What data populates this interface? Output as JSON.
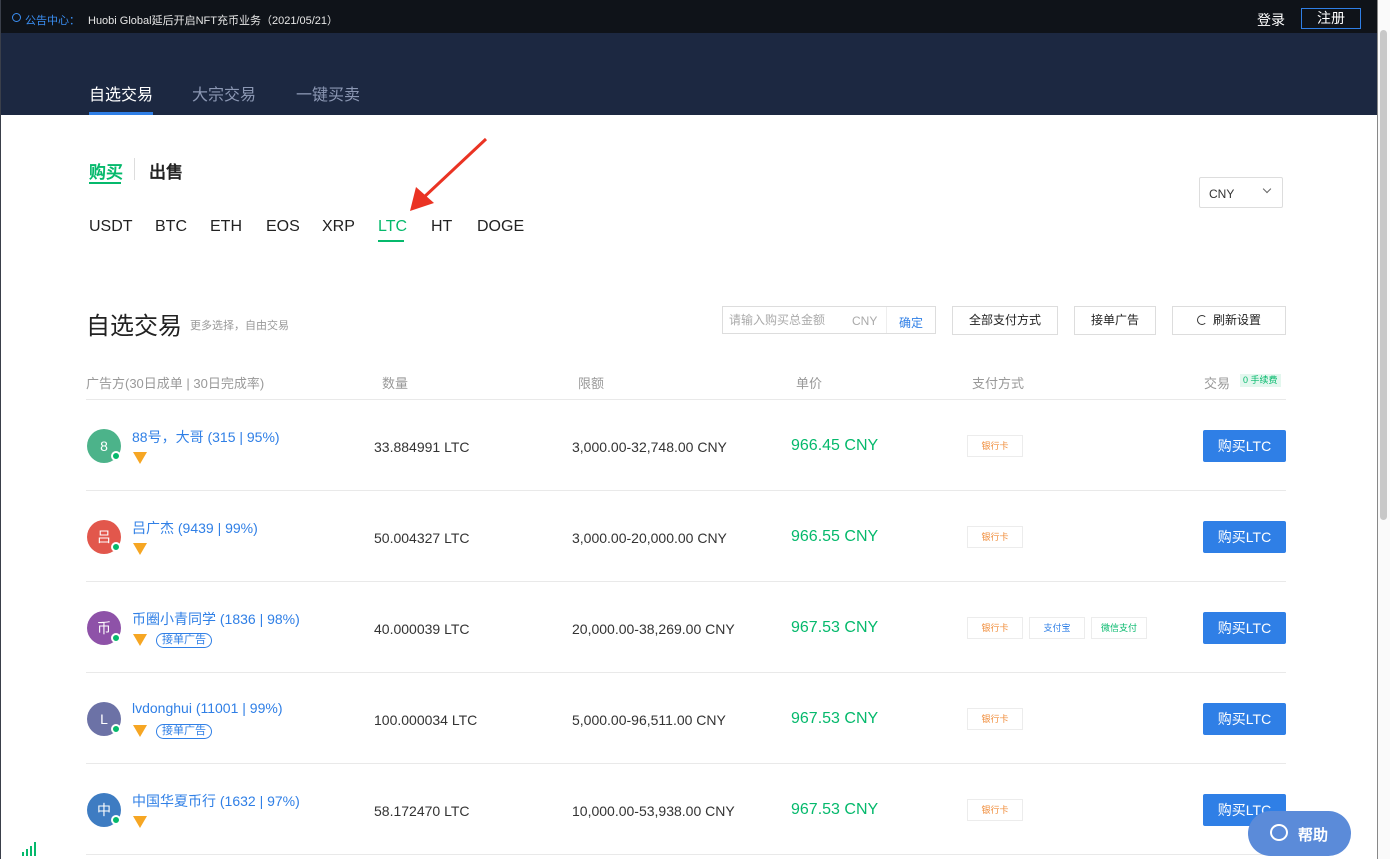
{
  "notice": {
    "label": "公告中心：",
    "text": "Huobi Global延后开启NFT充币业务（2021/05/21）",
    "login": "登录",
    "register": "注册"
  },
  "nav": {
    "tabs": [
      {
        "label": "自选交易",
        "active": true
      },
      {
        "label": "大宗交易",
        "active": false
      },
      {
        "label": "一键买卖",
        "active": false
      }
    ]
  },
  "side": {
    "buy": "购买",
    "sell": "出售"
  },
  "coins": [
    "USDT",
    "BTC",
    "ETH",
    "EOS",
    "XRP",
    "LTC",
    "HT",
    "DOGE"
  ],
  "active_coin": "LTC",
  "currency": {
    "selected": "CNY"
  },
  "section": {
    "title": "自选交易",
    "subtitle": "更多选择，自由交易"
  },
  "filters": {
    "amount_placeholder": "请输入购买总金额",
    "amount_unit": "CNY",
    "confirm": "确定",
    "payment_all": "全部支付方式",
    "take_ad": "接单广告",
    "refresh": "刷新设置"
  },
  "table": {
    "headers": {
      "merchant": "广告方(30日成单 | 30日完成率)",
      "quantity": "数量",
      "limit": "限额",
      "price": "单价",
      "payment": "支付方式",
      "trade": "交易",
      "fee_badge": "0 手续费"
    },
    "rows": [
      {
        "avatar": "8",
        "avatar_color": "#4cb38a",
        "name": "88号，大哥 (315 | 95%)",
        "maker": false,
        "qty": "33.884991 LTC",
        "limit": "3,000.00-32,748.00 CNY",
        "price": "966.45 CNY",
        "payments": [
          "银行卡"
        ],
        "action": "购买LTC"
      },
      {
        "avatar": "吕",
        "avatar_color": "#e2574c",
        "name": "吕广杰 (9439 | 99%)",
        "maker": false,
        "qty": "50.004327 LTC",
        "limit": "3,000.00-20,000.00 CNY",
        "price": "966.55 CNY",
        "payments": [
          "银行卡"
        ],
        "action": "购买LTC"
      },
      {
        "avatar": "币",
        "avatar_color": "#8e52a8",
        "name": "币圈小青同学 (1836 | 98%)",
        "maker": true,
        "maker_label": "接单广告",
        "qty": "40.000039 LTC",
        "limit": "20,000.00-38,269.00 CNY",
        "price": "967.53 CNY",
        "payments": [
          "银行卡",
          "支付宝",
          "微信支付"
        ],
        "action": "购买LTC"
      },
      {
        "avatar": "L",
        "avatar_color": "#6c72a6",
        "name": "lvdonghui (11001 | 99%)",
        "maker": true,
        "maker_label": "接单广告",
        "qty": "100.000034 LTC",
        "limit": "5,000.00-96,511.00 CNY",
        "price": "967.53 CNY",
        "payments": [
          "银行卡"
        ],
        "action": "购买LTC"
      },
      {
        "avatar": "中",
        "avatar_color": "#3e7cc2",
        "name": "中国华夏币行 (1632 | 97%)",
        "maker": false,
        "qty": "58.172470 LTC",
        "limit": "10,000.00-53,938.00 CNY",
        "price": "967.53 CNY",
        "payments": [
          "银行卡"
        ],
        "action": "购买LTC"
      }
    ]
  },
  "help": {
    "label": "帮助"
  },
  "colors": {
    "header_bg": "#1c2841",
    "notice_bg": "#0f1319",
    "accent_blue": "#2f7fe6",
    "accent_green": "#05b96c",
    "annotation_red": "#ea3323"
  }
}
